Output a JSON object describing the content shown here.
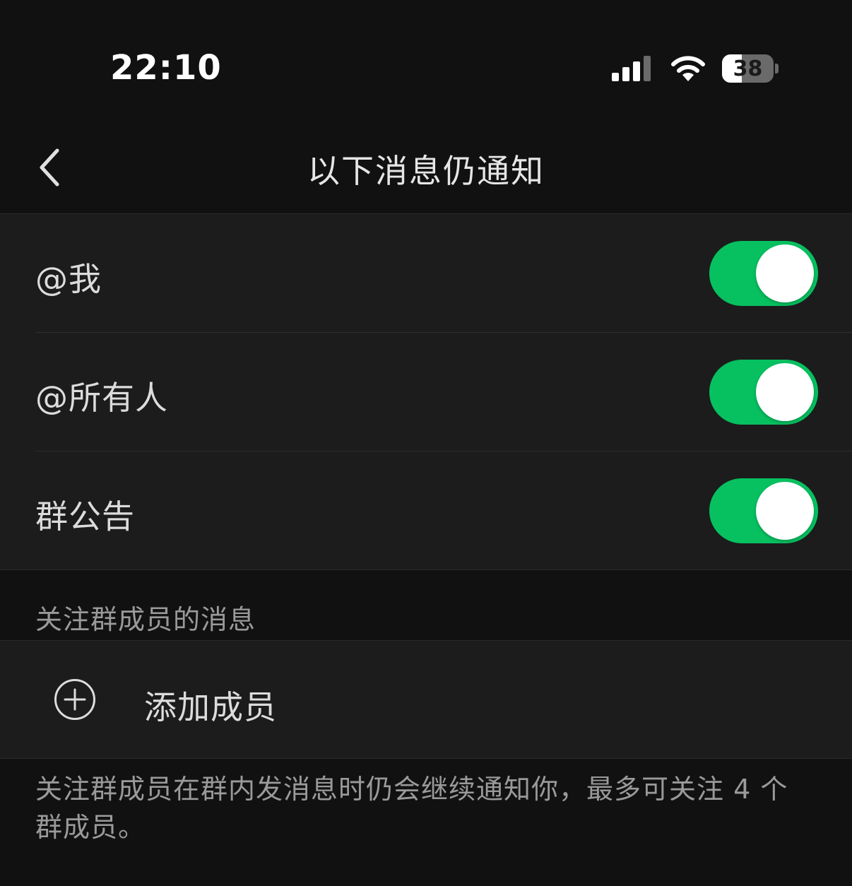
{
  "status_bar": {
    "time": "22:10",
    "battery_level": "38",
    "battery_fraction": 0.38,
    "icons": [
      "signal-icon",
      "wifi-icon",
      "battery-icon"
    ]
  },
  "nav": {
    "back_icon": "chevron-left-icon",
    "title": "以下消息仍通知"
  },
  "settings": {
    "items": [
      {
        "label": "@我",
        "enabled": true
      },
      {
        "label": "@所有人",
        "enabled": true
      },
      {
        "label": "群公告",
        "enabled": true
      }
    ]
  },
  "follow_section": {
    "header": "关注群成员的消息",
    "add_icon": "plus-circle-icon",
    "add_label": "添加成员",
    "note": "关注群成员在群内发消息时仍会继续通知你，最多可关注 4 个群成员。"
  },
  "colors": {
    "background": "#111111",
    "cell": "#1c1c1c",
    "accent_green": "#07c160",
    "secondary_text": "#9a9a9a"
  }
}
